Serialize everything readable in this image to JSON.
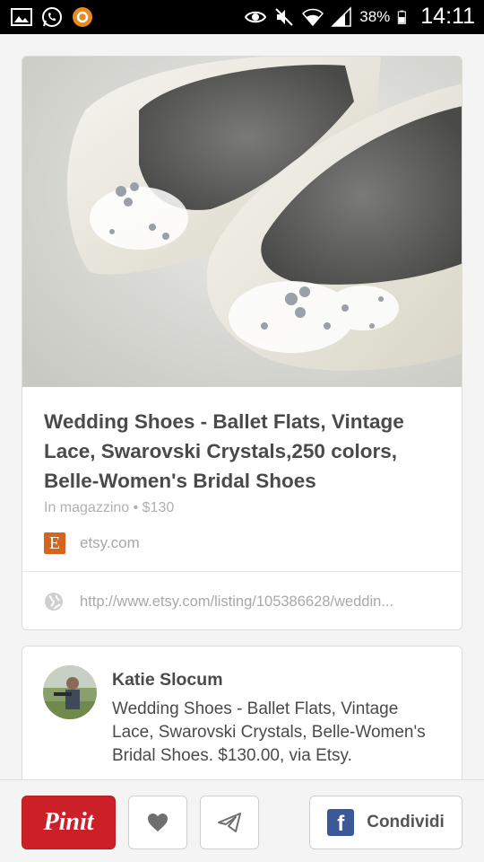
{
  "status_bar": {
    "icons": [
      "gallery-icon",
      "whatsapp-icon",
      "app-icon",
      "eye-icon",
      "mute-icon",
      "wifi-icon",
      "signal-icon",
      "battery-icon"
    ],
    "battery": "38%",
    "time": "14:11"
  },
  "pin": {
    "image_alt": "Ivory lace ballet flats with crystals",
    "title": "Wedding Shoes - Ballet Flats, Vintage Lace, Swarovski Crystals,250 colors, Belle-Women's Bridal Shoes",
    "meta": "In magazzino • $130",
    "source_logo_letter": "E",
    "source_domain": "etsy.com",
    "link_url": "http://www.etsy.com/listing/105386628/weddin..."
  },
  "pinner": {
    "name": "Katie Slocum",
    "description": "Wedding Shoes - Ballet Flats, Vintage Lace, Swarovski Crystals, Belle-Women's Bridal Shoes. $130.00, via Etsy."
  },
  "actions": {
    "pinit_label": "Pinit",
    "like_icon": "heart-icon",
    "send_icon": "send-icon",
    "share_logo": "f",
    "share_label": "Condividi"
  },
  "colors": {
    "pinit_red": "#cb2027",
    "facebook_blue": "#3b5998",
    "etsy_orange": "#d5641c"
  }
}
